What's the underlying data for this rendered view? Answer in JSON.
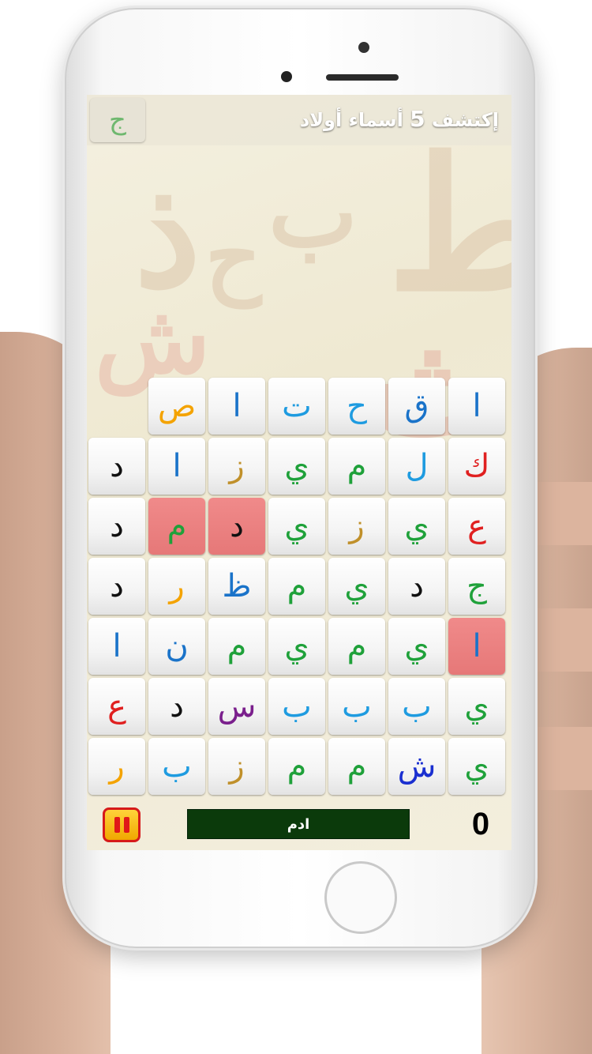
{
  "header": {
    "title_prefix": "إكتشف",
    "title_count": "5",
    "title_suffix": "أسماء أولاد",
    "hint_letter": "ج"
  },
  "background_letters": [
    "ذ",
    "ط",
    "ث",
    "ب",
    "ش",
    "ح"
  ],
  "grid": {
    "rows": [
      [
        {
          "char": "ا",
          "color": "#1a73c9"
        },
        {
          "char": "ق",
          "color": "#1a73c9"
        },
        {
          "char": "ح",
          "color": "#1e9be0"
        },
        {
          "char": "ت",
          "color": "#1e9be0"
        },
        {
          "char": "ا",
          "color": "#1a73c9"
        },
        {
          "char": "ص",
          "color": "#f4a300"
        }
      ],
      [
        {
          "char": "ك",
          "color": "#e02020"
        },
        {
          "char": "ل",
          "color": "#1e9be0"
        },
        {
          "char": "م",
          "color": "#1fa13a"
        },
        {
          "char": "ي",
          "color": "#1fa13a"
        },
        {
          "char": "ز",
          "color": "#c0902a"
        },
        {
          "char": "ا",
          "color": "#1a73c9"
        },
        {
          "char": "د",
          "color": "#111111"
        }
      ],
      [
        {
          "char": "ع",
          "color": "#e02020"
        },
        {
          "char": "ي",
          "color": "#1fa13a"
        },
        {
          "char": "ز",
          "color": "#c0902a"
        },
        {
          "char": "ي",
          "color": "#1fa13a"
        },
        {
          "char": "د",
          "color": "#111111",
          "selected": true
        },
        {
          "char": "م",
          "color": "#1fa13a",
          "selected": true
        },
        {
          "char": "د",
          "color": "#111111"
        }
      ],
      [
        {
          "char": "ج",
          "color": "#1fa13a"
        },
        {
          "char": "د",
          "color": "#111111"
        },
        {
          "char": "ي",
          "color": "#1fa13a"
        },
        {
          "char": "م",
          "color": "#1fa13a"
        },
        {
          "char": "ظ",
          "color": "#1a73c9"
        },
        {
          "char": "ر",
          "color": "#f4a300"
        },
        {
          "char": "د",
          "color": "#111111"
        }
      ],
      [
        {
          "char": "ا",
          "color": "#1a73c9",
          "selected": true
        },
        {
          "char": "ي",
          "color": "#1fa13a"
        },
        {
          "char": "م",
          "color": "#1fa13a"
        },
        {
          "char": "ي",
          "color": "#1fa13a"
        },
        {
          "char": "م",
          "color": "#1fa13a"
        },
        {
          "char": "ن",
          "color": "#1a73c9"
        },
        {
          "char": "ا",
          "color": "#1a73c9"
        }
      ],
      [
        {
          "char": "ي",
          "color": "#1fa13a"
        },
        {
          "char": "ب",
          "color": "#1e9be0"
        },
        {
          "char": "ب",
          "color": "#1e9be0"
        },
        {
          "char": "ب",
          "color": "#1e9be0"
        },
        {
          "char": "س",
          "color": "#7a1f8c"
        },
        {
          "char": "د",
          "color": "#111111"
        },
        {
          "char": "ع",
          "color": "#e02020"
        }
      ],
      [
        {
          "char": "ي",
          "color": "#1fa13a"
        },
        {
          "char": "ش",
          "color": "#1a2fd0"
        },
        {
          "char": "م",
          "color": "#1fa13a"
        },
        {
          "char": "م",
          "color": "#1fa13a"
        },
        {
          "char": "ز",
          "color": "#c0902a"
        },
        {
          "char": "ب",
          "color": "#1e9be0"
        },
        {
          "char": "ر",
          "color": "#f4a300"
        }
      ]
    ]
  },
  "footer": {
    "current_word": "ادم",
    "score": "0"
  }
}
